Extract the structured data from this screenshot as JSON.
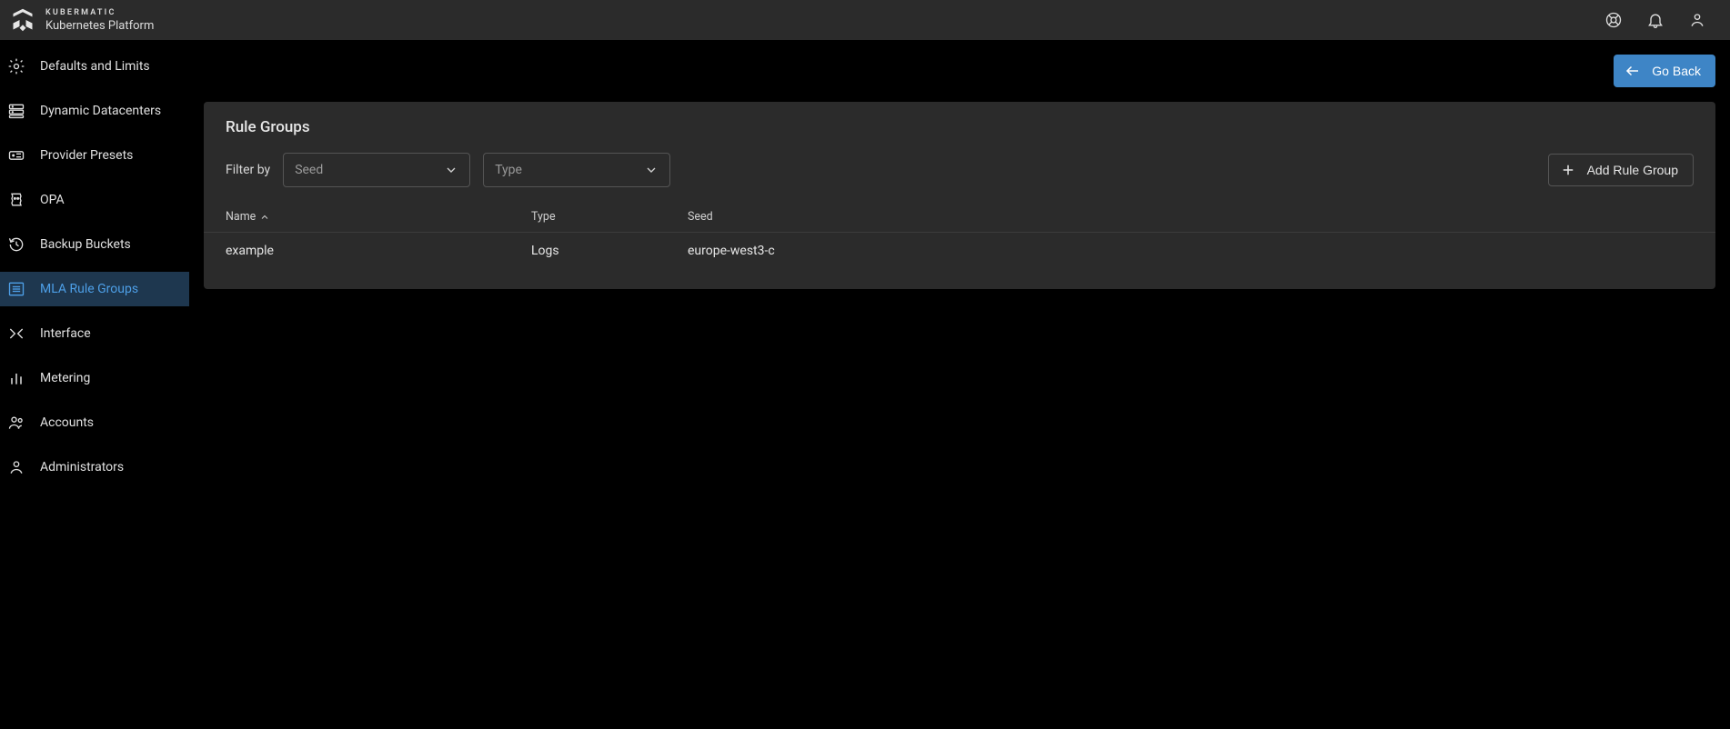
{
  "brand": {
    "top": "KUBERMATIC",
    "bottom": "Kubernetes Platform"
  },
  "header": {},
  "sidebar": {
    "items": [
      {
        "label": "Defaults and Limits"
      },
      {
        "label": "Dynamic Datacenters"
      },
      {
        "label": "Provider Presets"
      },
      {
        "label": "OPA"
      },
      {
        "label": "Backup Buckets"
      },
      {
        "label": "MLA Rule Groups"
      },
      {
        "label": "Interface"
      },
      {
        "label": "Metering"
      },
      {
        "label": "Accounts"
      },
      {
        "label": "Administrators"
      }
    ]
  },
  "actions": {
    "go_back": "Go Back",
    "add_rule_group": "Add Rule Group"
  },
  "card": {
    "title": "Rule Groups",
    "filter_label": "Filter by",
    "seed_placeholder": "Seed",
    "type_placeholder": "Type"
  },
  "table": {
    "headers": {
      "name": "Name",
      "type": "Type",
      "seed": "Seed"
    },
    "rows": [
      {
        "name": "example",
        "type": "Logs",
        "seed": "europe-west3-c"
      }
    ]
  }
}
